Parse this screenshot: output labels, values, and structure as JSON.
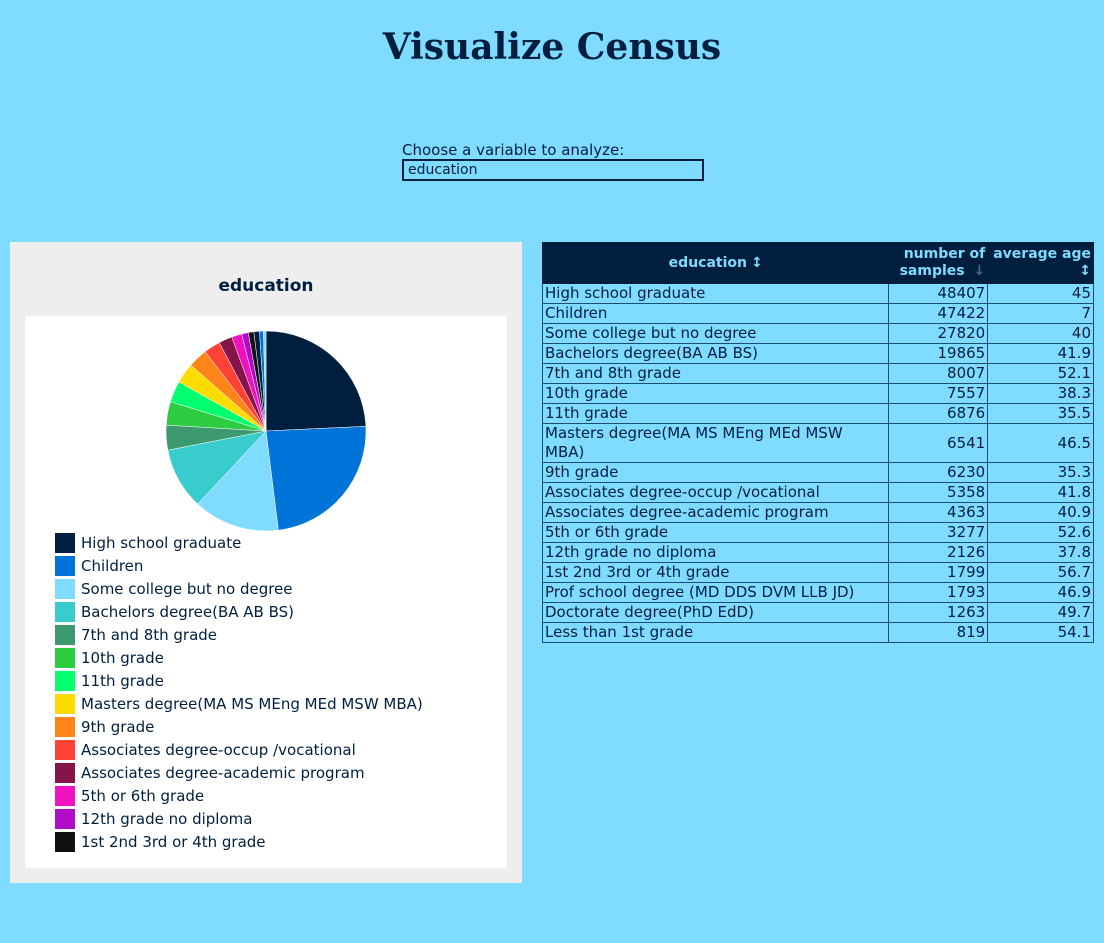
{
  "title": "Visualize Census",
  "selector": {
    "label": "Choose a variable to analyze:",
    "value": "education"
  },
  "chart_data": {
    "type": "pie",
    "title": "education",
    "slices": [
      {
        "label": "High school graduate",
        "value": 48407,
        "color": "#001f3f"
      },
      {
        "label": "Children",
        "value": 47422,
        "color": "#0074d9"
      },
      {
        "label": "Some college but no degree",
        "value": 27820,
        "color": "#7fdbff"
      },
      {
        "label": "Bachelors degree(BA AB BS)",
        "value": 19865,
        "color": "#39cccc"
      },
      {
        "label": "7th and 8th grade",
        "value": 8007,
        "color": "#3d9970"
      },
      {
        "label": "10th grade",
        "value": 7557,
        "color": "#2ecc40"
      },
      {
        "label": "11th grade",
        "value": 6876,
        "color": "#01ff70"
      },
      {
        "label": "Masters degree(MA MS MEng MEd MSW MBA)",
        "value": 6541,
        "color": "#ffdc00"
      },
      {
        "label": "9th grade",
        "value": 6230,
        "color": "#ff851b"
      },
      {
        "label": "Associates degree-occup /vocational",
        "value": 5358,
        "color": "#ff4136"
      },
      {
        "label": "Associates degree-academic program",
        "value": 4363,
        "color": "#85144b"
      },
      {
        "label": "5th or 6th grade",
        "value": 3277,
        "color": "#f012be"
      },
      {
        "label": "12th grade no diploma",
        "value": 2126,
        "color": "#b10dc9"
      },
      {
        "label": "1st 2nd 3rd or 4th grade",
        "value": 1799,
        "color": "#111111"
      },
      {
        "label": "Prof school degree (MD DDS DVM LLB JD)",
        "value": 1793,
        "color": "#001f3f"
      },
      {
        "label": "Doctorate degree(PhD EdD)",
        "value": 1263,
        "color": "#0074d9"
      },
      {
        "label": "Less than 1st grade",
        "value": 819,
        "color": "#7fdbff"
      }
    ],
    "legend_count": 14
  },
  "table": {
    "headers": {
      "education": "education",
      "samples": "number of samples",
      "age": "average age"
    },
    "sort_icons": {
      "education": "↕",
      "samples": "↓",
      "age": "↕"
    },
    "rows": [
      {
        "education": "High school graduate",
        "samples": "48407",
        "age": "45"
      },
      {
        "education": "Children",
        "samples": "47422",
        "age": "7"
      },
      {
        "education": "Some college but no degree",
        "samples": "27820",
        "age": "40"
      },
      {
        "education": "Bachelors degree(BA AB BS)",
        "samples": "19865",
        "age": "41.9"
      },
      {
        "education": "7th and 8th grade",
        "samples": "8007",
        "age": "52.1"
      },
      {
        "education": "10th grade",
        "samples": "7557",
        "age": "38.3"
      },
      {
        "education": "11th grade",
        "samples": "6876",
        "age": "35.5"
      },
      {
        "education": "Masters degree(MA MS MEng MEd MSW MBA)",
        "samples": "6541",
        "age": "46.5"
      },
      {
        "education": "9th grade",
        "samples": "6230",
        "age": "35.3"
      },
      {
        "education": "Associates degree-occup /vocational",
        "samples": "5358",
        "age": "41.8"
      },
      {
        "education": "Associates degree-academic program",
        "samples": "4363",
        "age": "40.9"
      },
      {
        "education": "5th or 6th grade",
        "samples": "3277",
        "age": "52.6"
      },
      {
        "education": "12th grade no diploma",
        "samples": "2126",
        "age": "37.8"
      },
      {
        "education": "1st 2nd 3rd or 4th grade",
        "samples": "1799",
        "age": "56.7"
      },
      {
        "education": "Prof school degree (MD DDS DVM LLB JD)",
        "samples": "1793",
        "age": "46.9"
      },
      {
        "education": "Doctorate degree(PhD EdD)",
        "samples": "1263",
        "age": "49.7"
      },
      {
        "education": "Less than 1st grade",
        "samples": "819",
        "age": "54.1"
      }
    ]
  }
}
